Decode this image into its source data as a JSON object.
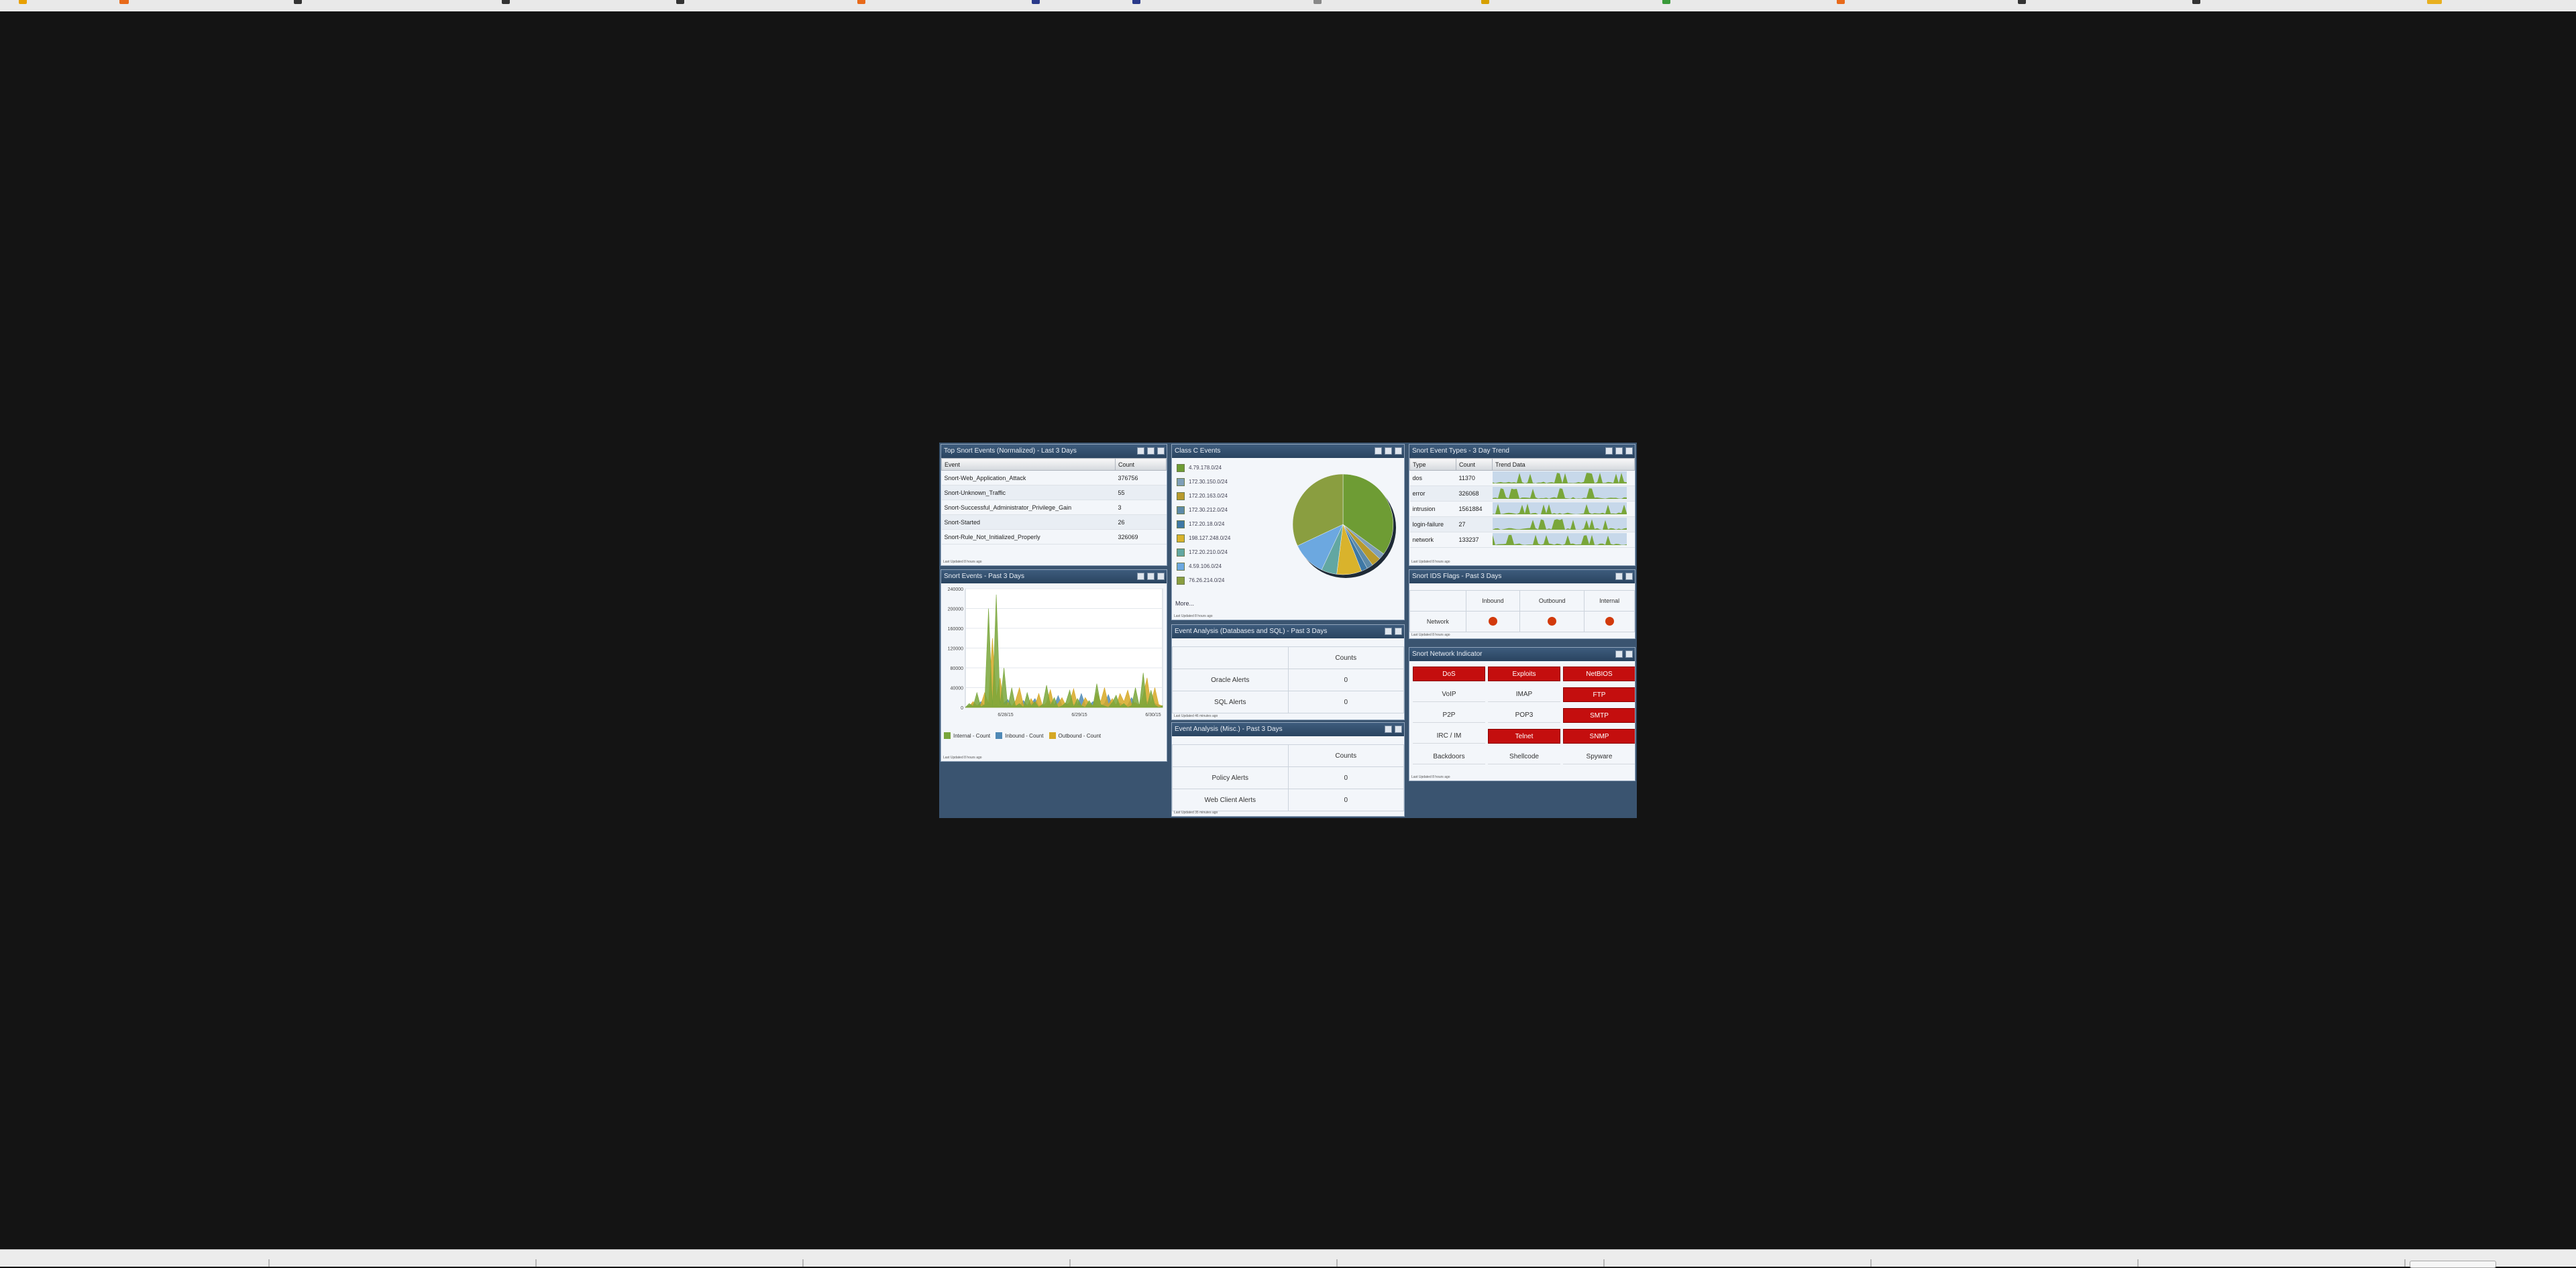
{
  "colors": {
    "desktop_bg": "#141414",
    "panel_header": "#2f4a66",
    "alert_red": "#c40e0e",
    "flag_orange": "#d23a0c",
    "series_green": "#79a63a",
    "series_blue": "#4f89b6",
    "series_gold": "#d6a824"
  },
  "top_events": {
    "title": "Top Snort Events (Normalized) - Last 3 Days",
    "col_event": "Event",
    "col_count": "Count",
    "rows": [
      {
        "event": "Snort-Web_Application_Attack",
        "count": "376756"
      },
      {
        "event": "Snort-Unknown_Traffic",
        "count": "55"
      },
      {
        "event": "Snort-Successful_Administrator_Privilege_Gain",
        "count": "3"
      },
      {
        "event": "Snort-Started",
        "count": "26"
      },
      {
        "event": "Snort-Rule_Not_Initialized_Properly",
        "count": "326069"
      }
    ],
    "footer": "Last Updated 8 hours ago"
  },
  "snort_events": {
    "title": "Snort Events - Past 3 Days",
    "footer": "Last Updated 8 hours ago",
    "legend": [
      "Internal - Count",
      "Inbound - Count",
      "Outbound - Count"
    ]
  },
  "chart_data": [
    {
      "type": "area",
      "title": "Snort Events - Past 3 Days",
      "x_ticks": [
        "6/28/15",
        "6/29/15",
        "6/30/15"
      ],
      "y_ticks": [
        0,
        40000,
        80000,
        120000,
        160000,
        200000,
        240000
      ],
      "ylim": [
        0,
        240000
      ],
      "series": [
        {
          "name": "Internal - Count",
          "values": [
            0,
            8000,
            2000,
            30000,
            1000,
            6000,
            200000,
            2000,
            228000,
            5000,
            80000,
            0,
            40000,
            2000,
            8000,
            0,
            30000,
            3000,
            12000,
            0,
            6000,
            45000,
            4000,
            20000,
            0,
            3000,
            10000,
            35000,
            1000,
            18000,
            4000,
            0,
            14000,
            2000,
            48000,
            6000,
            3000,
            0,
            10000,
            25000,
            2000,
            8000,
            0,
            4000,
            40000,
            3000,
            70000,
            2000,
            35000,
            5000,
            0,
            4000
          ]
        },
        {
          "name": "Inbound - Count",
          "values": [
            0,
            4000,
            8000,
            2000,
            12000,
            3000,
            10000,
            4000,
            6000,
            2000,
            9000,
            16000,
            3000,
            5000,
            2000,
            14000,
            4000,
            7000,
            18000,
            3000,
            6000,
            3000,
            12000,
            5000,
            24000,
            4000,
            8000,
            3000,
            6000,
            4000,
            28000,
            6000,
            4000,
            12000,
            5000,
            3000,
            8000,
            26000,
            4000,
            6000,
            9000,
            3000,
            5000,
            20000,
            4000,
            6000,
            5000,
            12000,
            3000,
            8000,
            5000,
            2000
          ]
        },
        {
          "name": "Outbound - Count",
          "values": [
            0,
            2000,
            12000,
            4000,
            6000,
            30000,
            8000,
            140000,
            20000,
            60000,
            5000,
            10000,
            2000,
            14000,
            40000,
            6000,
            3000,
            18000,
            4000,
            28000,
            2000,
            10000,
            36000,
            3000,
            8000,
            20000,
            4000,
            10000,
            38000,
            6000,
            2000,
            20000,
            8000,
            4000,
            30000,
            12000,
            40000,
            6000,
            18000,
            4000,
            28000,
            12000,
            35000,
            6000,
            10000,
            4000,
            25000,
            60000,
            8000,
            40000,
            6000,
            3000
          ]
        }
      ]
    },
    {
      "type": "pie",
      "title": "Class C Events",
      "categories": [
        "4.79.178.0/24",
        "172.30.150.0/24",
        "172.20.163.0/24",
        "172.30.212.0/24",
        "172.20.18.0/24",
        "198.127.248.0/24",
        "172.20.210.0/24",
        "4.59.106.0/24",
        "76.26.214.0/24"
      ],
      "values": [
        35,
        2,
        3,
        2,
        2,
        8,
        5,
        11,
        32
      ]
    }
  ],
  "class_c": {
    "title": "Class C Events",
    "items": [
      {
        "label": "4.79.178.0/24",
        "color": "#6e9c34"
      },
      {
        "label": "172.30.150.0/24",
        "color": "#7f9fb8"
      },
      {
        "label": "172.20.163.0/24",
        "color": "#b89a2c"
      },
      {
        "label": "172.30.212.0/24",
        "color": "#5d8aa8"
      },
      {
        "label": "172.20.18.0/24",
        "color": "#3e78a5"
      },
      {
        "label": "198.127.248.0/24",
        "color": "#d9b32c"
      },
      {
        "label": "172.20.210.0/24",
        "color": "#62a7a2"
      },
      {
        "label": "4.59.106.0/24",
        "color": "#6ca8e0"
      },
      {
        "label": "76.26.214.0/24",
        "color": "#8a9e40"
      }
    ],
    "more": "More...",
    "footer": "Last Updated 8 hours ago"
  },
  "event_db": {
    "title": "Event Analysis (Databases and SQL) - Past 3 Days",
    "col_counts": "Counts",
    "rows": [
      {
        "label": "Oracle Alerts",
        "value": "0"
      },
      {
        "label": "SQL Alerts",
        "value": "0"
      }
    ],
    "footer": "Last Updated 46 minutes ago"
  },
  "event_misc": {
    "title": "Event Analysis (Misc.) - Past 3 Days",
    "col_counts": "Counts",
    "rows": [
      {
        "label": "Policy Alerts",
        "value": "0"
      },
      {
        "label": "Web Client Alerts",
        "value": "0"
      }
    ],
    "footer": "Last Updated 35 minutes ago"
  },
  "trend": {
    "title": "Snort Event Types - 3 Day Trend",
    "col_type": "Type",
    "col_count": "Count",
    "col_trend": "Trend Data",
    "rows": [
      {
        "type": "dos",
        "count": "11370"
      },
      {
        "type": "error",
        "count": "326068"
      },
      {
        "type": "intrusion",
        "count": "1561884"
      },
      {
        "type": "login-failure",
        "count": "27"
      },
      {
        "type": "network",
        "count": "133237"
      }
    ],
    "footer": "Last Updated 8 hours ago"
  },
  "ids_flags": {
    "title": "Snort IDS Flags - Past 3 Days",
    "col_inbound": "Inbound",
    "col_outbound": "Outbound",
    "col_internal": "Internal",
    "row_label": "Network",
    "footer": "Last Updated 8 hours ago"
  },
  "network_indicator": {
    "title": "Snort Network Indicator",
    "items": [
      {
        "label": "DoS",
        "active": true
      },
      {
        "label": "Exploits",
        "active": true
      },
      {
        "label": "NetBIOS",
        "active": true
      },
      {
        "label": "VoIP",
        "active": false
      },
      {
        "label": "IMAP",
        "active": false
      },
      {
        "label": "FTP",
        "active": true
      },
      {
        "label": "P2P",
        "active": false
      },
      {
        "label": "POP3",
        "active": false
      },
      {
        "label": "SMTP",
        "active": true
      },
      {
        "label": "IRC / IM",
        "active": false
      },
      {
        "label": "Telnet",
        "active": true
      },
      {
        "label": "SNMP",
        "active": true
      },
      {
        "label": "Backdoors",
        "active": false
      },
      {
        "label": "Shellcode",
        "active": false
      },
      {
        "label": "Spyware",
        "active": false
      }
    ],
    "footer": "Last Updated 8 hours ago"
  }
}
